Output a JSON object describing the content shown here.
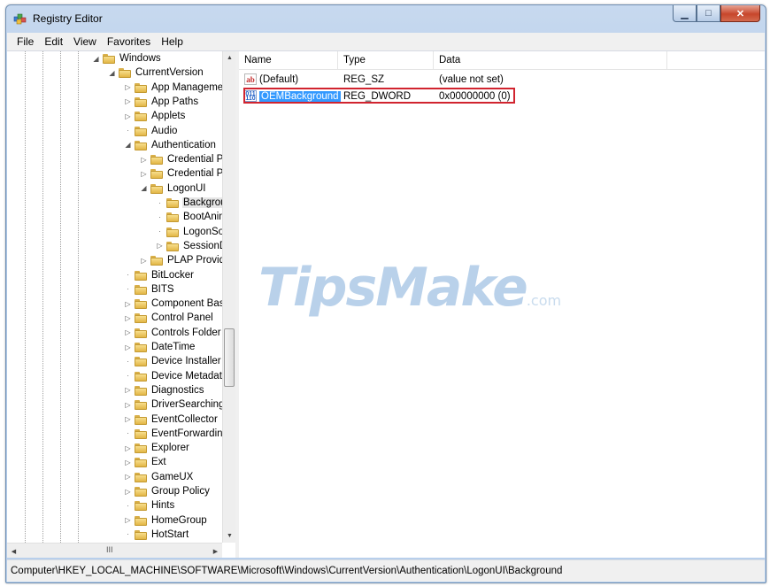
{
  "window": {
    "title": "Registry Editor"
  },
  "menu": [
    "File",
    "Edit",
    "View",
    "Favorites",
    "Help"
  ],
  "tree": {
    "nodes": [
      {
        "label": "Windows",
        "level": 0,
        "expander": "expanded",
        "selected": false
      },
      {
        "label": "CurrentVersion",
        "level": 1,
        "expander": "expanded",
        "selected": false
      },
      {
        "label": "App Managemer",
        "level": 2,
        "expander": "collapsed",
        "selected": false
      },
      {
        "label": "App Paths",
        "level": 2,
        "expander": "collapsed",
        "selected": false
      },
      {
        "label": "Applets",
        "level": 2,
        "expander": "collapsed",
        "selected": false
      },
      {
        "label": "Audio",
        "level": 2,
        "expander": "none",
        "selected": false
      },
      {
        "label": "Authentication",
        "level": 2,
        "expander": "expanded",
        "selected": false
      },
      {
        "label": "Credential Prc",
        "level": 3,
        "expander": "collapsed",
        "selected": false
      },
      {
        "label": "Credential Prc",
        "level": 3,
        "expander": "collapsed",
        "selected": false
      },
      {
        "label": "LogonUI",
        "level": 3,
        "expander": "expanded",
        "selected": false
      },
      {
        "label": "Backgrour",
        "level": 4,
        "expander": "none",
        "selected": true
      },
      {
        "label": "BootAnim",
        "level": 4,
        "expander": "none",
        "selected": false
      },
      {
        "label": "LogonSou",
        "level": 4,
        "expander": "none",
        "selected": false
      },
      {
        "label": "SessionDa",
        "level": 4,
        "expander": "collapsed",
        "selected": false
      },
      {
        "label": "PLAP Provide",
        "level": 3,
        "expander": "collapsed",
        "selected": false
      },
      {
        "label": "BitLocker",
        "level": 2,
        "expander": "none",
        "selected": false
      },
      {
        "label": "BITS",
        "level": 2,
        "expander": "none",
        "selected": false
      },
      {
        "label": "Component Base",
        "level": 2,
        "expander": "collapsed",
        "selected": false
      },
      {
        "label": "Control Panel",
        "level": 2,
        "expander": "collapsed",
        "selected": false
      },
      {
        "label": "Controls Folder",
        "level": 2,
        "expander": "collapsed",
        "selected": false
      },
      {
        "label": "DateTime",
        "level": 2,
        "expander": "collapsed",
        "selected": false
      },
      {
        "label": "Device Installer",
        "level": 2,
        "expander": "none",
        "selected": false
      },
      {
        "label": "Device Metadata",
        "level": 2,
        "expander": "none",
        "selected": false
      },
      {
        "label": "Diagnostics",
        "level": 2,
        "expander": "collapsed",
        "selected": false
      },
      {
        "label": "DriverSearching",
        "level": 2,
        "expander": "collapsed",
        "selected": false
      },
      {
        "label": "EventCollector",
        "level": 2,
        "expander": "collapsed",
        "selected": false
      },
      {
        "label": "EventForwarding",
        "level": 2,
        "expander": "none",
        "selected": false
      },
      {
        "label": "Explorer",
        "level": 2,
        "expander": "collapsed",
        "selected": false
      },
      {
        "label": "Ext",
        "level": 2,
        "expander": "collapsed",
        "selected": false
      },
      {
        "label": "GameUX",
        "level": 2,
        "expander": "collapsed",
        "selected": false
      },
      {
        "label": "Group Policy",
        "level": 2,
        "expander": "collapsed",
        "selected": false
      },
      {
        "label": "Hints",
        "level": 2,
        "expander": "none",
        "selected": false
      },
      {
        "label": "HomeGroup",
        "level": 2,
        "expander": "collapsed",
        "selected": false
      },
      {
        "label": "HotStart",
        "level": 2,
        "expander": "none",
        "selected": false
      }
    ],
    "hscroll_grip": "III"
  },
  "values": {
    "columns": [
      "Name",
      "Type",
      "Data"
    ],
    "rows": [
      {
        "icon": "string-value-icon",
        "icon_text": "ab",
        "name": "(Default)",
        "type": "REG_SZ",
        "data": "(value not set)",
        "selected": false
      },
      {
        "icon": "dword-value-icon",
        "icon_text": "011\n110",
        "name": "OEMBackground",
        "type": "REG_DWORD",
        "data": "0x00000000 (0)",
        "selected": true
      }
    ],
    "highlight_color": "#d1242f",
    "selection_color": "#3399ff"
  },
  "watermark": {
    "text": "TipsMake",
    "suffix": ".com"
  },
  "status": {
    "path": "Computer\\HKEY_LOCAL_MACHINE\\SOFTWARE\\Microsoft\\Windows\\CurrentVersion\\Authentication\\LogonUI\\Background"
  }
}
